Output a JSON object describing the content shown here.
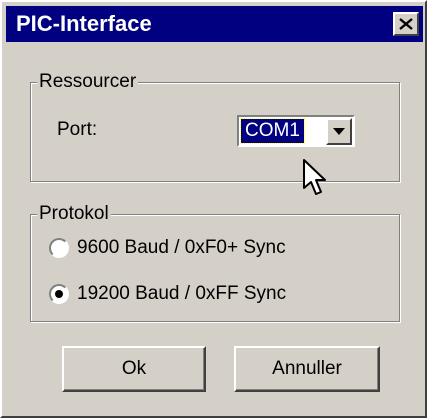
{
  "window": {
    "title": "PIC-Interface",
    "close_icon": "close-icon"
  },
  "resources": {
    "legend": "Ressourcer",
    "port_label": "Port:",
    "port_value": "COM1"
  },
  "protocol": {
    "legend": "Protokol",
    "options": [
      {
        "label": "9600 Baud / 0xF0+ Sync",
        "selected": false
      },
      {
        "label": "19200 Baud / 0xFF Sync",
        "selected": true
      }
    ]
  },
  "buttons": {
    "ok": "Ok",
    "cancel": "Annuller"
  },
  "colors": {
    "titlebar": "#000080",
    "face": "#d4d0c8",
    "selection": "#000080"
  }
}
